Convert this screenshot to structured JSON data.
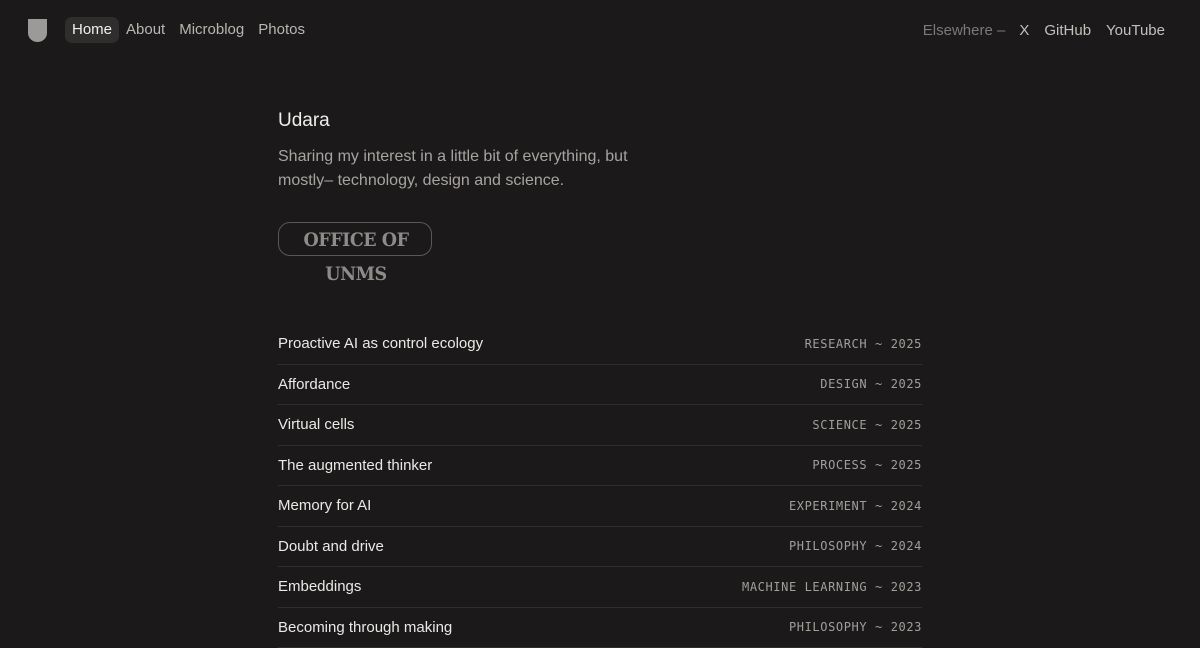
{
  "nav": {
    "logo_icon": "shield-logo-icon",
    "items": [
      {
        "label": "Home",
        "active": true
      },
      {
        "label": "About"
      },
      {
        "label": "Microblog"
      },
      {
        "label": "Photos"
      }
    ]
  },
  "elsewhere": {
    "label": "Elsewhere –",
    "links": [
      "X",
      "GitHub",
      "YouTube"
    ]
  },
  "profile": {
    "name": "Udara",
    "tagline": "Sharing my interest in a little bit of everything, but mostly– technology, design and science.",
    "badge": "OFFICE OF UNMS"
  },
  "posts": [
    {
      "title": "Proactive AI as control ecology",
      "category": "RESEARCH",
      "year": "2025"
    },
    {
      "title": "Affordance",
      "category": "DESIGN",
      "year": "2025"
    },
    {
      "title": "Virtual cells",
      "category": "SCIENCE",
      "year": "2025"
    },
    {
      "title": "The augmented thinker",
      "category": "PROCESS",
      "year": "2025"
    },
    {
      "title": "Memory for AI",
      "category": "EXPERIMENT",
      "year": "2024"
    },
    {
      "title": "Doubt and drive",
      "category": "PHILOSOPHY",
      "year": "2024"
    },
    {
      "title": "Embeddings",
      "category": "MACHINE LEARNING",
      "year": "2023"
    },
    {
      "title": "Becoming through making",
      "category": "PHILOSOPHY",
      "year": "2023"
    }
  ],
  "colors": {
    "background": "#1b1919",
    "active_nav_bg": "#302d2d",
    "divider": "#302e2d"
  }
}
